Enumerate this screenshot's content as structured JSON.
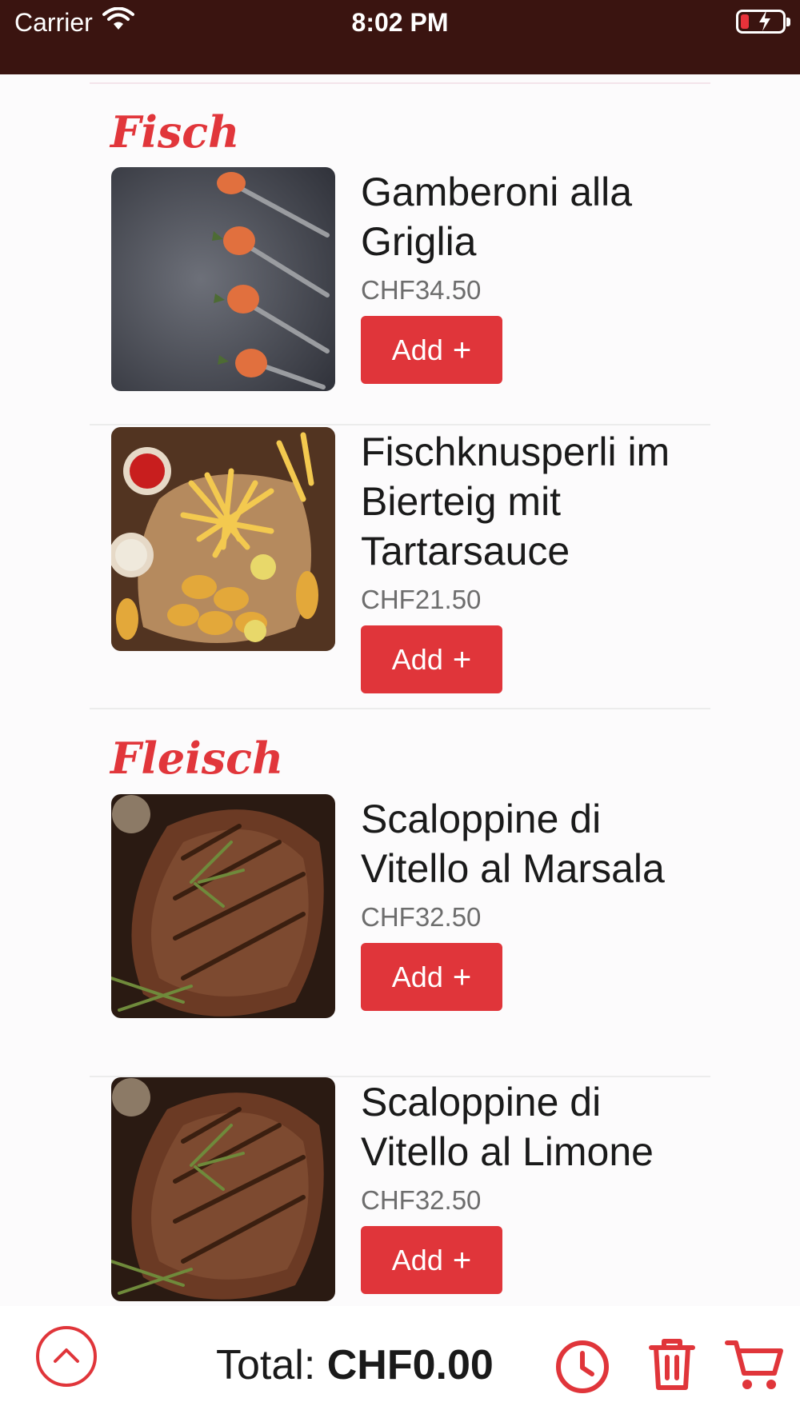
{
  "status": {
    "carrier": "Carrier",
    "time": "8:02 PM"
  },
  "sections": [
    {
      "title": "Fisch",
      "items": [
        {
          "name": "Gamberoni alla Griglia",
          "price": "CHF34.50",
          "add_label": "Add",
          "image": "shrimp-on-spoons"
        },
        {
          "name": "Fischknusperli im Bierteig mit Tartarsauce",
          "price": "CHF21.50",
          "add_label": "Add",
          "image": "fish-and-chips"
        }
      ]
    },
    {
      "title": "Fleisch",
      "items": [
        {
          "name": "Scaloppine di Vitello al Marsala",
          "price": "CHF32.50",
          "add_label": "Add",
          "image": "grilled-steak"
        },
        {
          "name": "Scaloppine di Vitello al Limone",
          "price": "CHF32.50",
          "add_label": "Add",
          "image": "grilled-steak"
        }
      ]
    }
  ],
  "bottom_bar": {
    "total_label": "Total:",
    "total_value": "CHF0.00"
  },
  "colors": {
    "accent": "#e0353a",
    "status_bar": "#3a1410",
    "background": "#fcfbfc"
  },
  "icons": [
    "wifi-icon",
    "battery-icon",
    "chevron-up-icon",
    "clock-icon",
    "trash-icon",
    "cart-icon",
    "plus-icon"
  ]
}
